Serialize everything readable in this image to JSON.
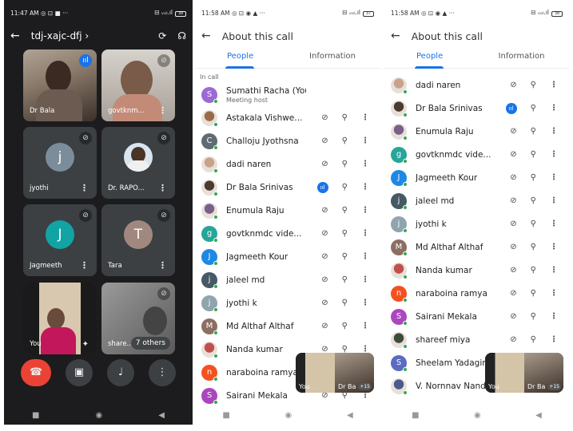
{
  "p1": {
    "time": "11:47 AM",
    "status_icons": "◎ ⊡ ■ ···",
    "signal": "⊟ ᵥₒₗ.ıl",
    "batt": "38",
    "title": "tdj-xajc-dfj ›",
    "tiles": [
      {
        "name": "Dr Bala"
      },
      {
        "name": "govtknm..."
      },
      {
        "name": "jyothi",
        "letter": "j",
        "color": "#7b8d9b"
      },
      {
        "name": "Dr. RAPO..."
      },
      {
        "name": "Jagmeeth",
        "letter": "J",
        "color": "#12a4a4"
      },
      {
        "name": "Tara",
        "letter": "T",
        "color": "#a1887f"
      },
      {
        "name": "You"
      },
      {
        "name": "share..."
      }
    ],
    "others": "7 others"
  },
  "p2": {
    "time": "11:58 AM",
    "status_icons": "◎ ⊡ ◉ ▲ ···",
    "signal": "⊟ ᵥₒₗ.ıl",
    "batt": "37",
    "title": "About this call",
    "tab1": "People",
    "tab2": "Information",
    "section": "In call",
    "rows": [
      {
        "name": "Sumathi Racha (You)",
        "sub": "Meeting host",
        "letter": "S",
        "color": "#9c6ad3",
        "icons": false
      },
      {
        "name": "Astakala Vishwe...",
        "photo": "#9a6a4a",
        "icons": true
      },
      {
        "name": "Challoju Jyothsna",
        "letter": "C",
        "color": "#5f6b73",
        "icons": true
      },
      {
        "name": "dadi naren",
        "photo": "#c8a38a",
        "icons": true
      },
      {
        "name": "Dr Bala Srinivas",
        "photo": "#4a3a30",
        "icons": true,
        "speaking": true
      },
      {
        "name": "Enumula Raju",
        "photo": "#7a5f8a",
        "icons": true
      },
      {
        "name": "govtknmdc vide...",
        "letter": "g",
        "color": "#26a69a",
        "icons": true
      },
      {
        "name": "Jagmeeth Kour",
        "letter": "J",
        "color": "#1e88e5",
        "icons": true
      },
      {
        "name": "jaleel md",
        "letter": "j",
        "color": "#455a64",
        "icons": true
      },
      {
        "name": "jyothi k",
        "letter": "j",
        "color": "#90a4ae",
        "icons": true
      },
      {
        "name": "Md Althaf Althaf",
        "letter": "M",
        "color": "#8d6e63",
        "icons": true
      },
      {
        "name": "Nanda kumar",
        "photo": "#c0504d",
        "icons": true
      },
      {
        "name": "naraboina ramya",
        "letter": "n",
        "color": "#f4511e",
        "icons": true
      },
      {
        "name": "Sairani Mekala",
        "letter": "S",
        "color": "#ab47bc",
        "icons": true
      }
    ],
    "pip": {
      "you": "You",
      "other": "Dr Ba",
      "count": "+15"
    }
  },
  "p3": {
    "time": "11:58 AM",
    "status_icons": "◎ ⊡ ◉ ▲ ···",
    "signal": "⊟ ᵥₒₗ.ıl",
    "batt": "38",
    "title": "About this call",
    "tab1": "People",
    "tab2": "Information",
    "rows": [
      {
        "name": "dadi naren",
        "photo": "#c8a38a",
        "icons": true
      },
      {
        "name": "Dr Bala Srinivas",
        "photo": "#4a3a30",
        "icons": true,
        "speaking": true
      },
      {
        "name": "Enumula Raju",
        "photo": "#7a5f8a",
        "icons": true
      },
      {
        "name": "govtknmdc vide...",
        "letter": "g",
        "color": "#26a69a",
        "icons": true
      },
      {
        "name": "Jagmeeth Kour",
        "letter": "J",
        "color": "#1e88e5",
        "icons": true
      },
      {
        "name": "jaleel md",
        "letter": "j",
        "color": "#455a64",
        "icons": true
      },
      {
        "name": "jyothi k",
        "letter": "j",
        "color": "#90a4ae",
        "icons": true
      },
      {
        "name": "Md Althaf Althaf",
        "letter": "M",
        "color": "#8d6e63",
        "icons": true
      },
      {
        "name": "Nanda kumar",
        "photo": "#c0504d",
        "icons": true
      },
      {
        "name": "naraboina ramya",
        "letter": "n",
        "color": "#f4511e",
        "icons": true
      },
      {
        "name": "Sairani Mekala",
        "letter": "S",
        "color": "#ab47bc",
        "icons": true
      },
      {
        "name": "shareef miya",
        "photo": "#3e4a3a",
        "icons": true
      },
      {
        "name": "Sheelam Yadagiri",
        "letter": "S",
        "color": "#5c6bc0",
        "icons": true
      },
      {
        "name": "V. Nornnav Nand",
        "photo": "#4a5a8a",
        "icons": true
      }
    ],
    "pip": {
      "you": "You",
      "other": "Dr Ba",
      "count": "+15"
    }
  }
}
